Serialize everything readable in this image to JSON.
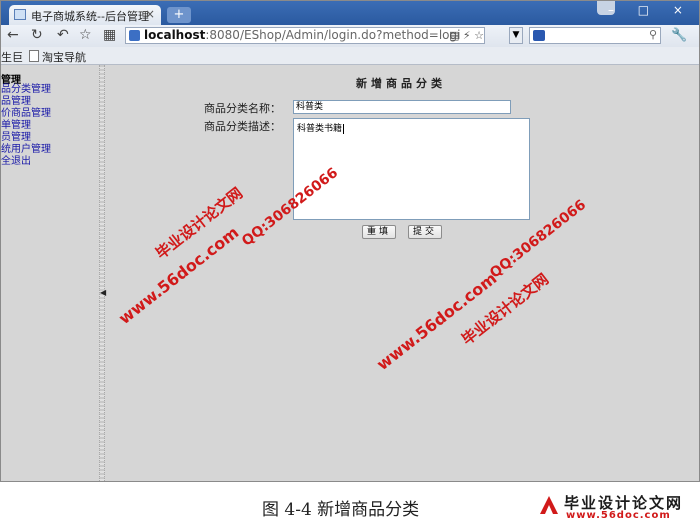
{
  "browser": {
    "tab_title": "电子商城系统--后台管理",
    "tab_close": "×",
    "new_tab": "+",
    "window_buttons": "– □ ×",
    "address_host": "localhost",
    "address_rest": ":8080/EShop/Admin/login.do?method=logi",
    "bookmarks": {
      "left_partial": "生巨",
      "taobao": "淘宝导航"
    }
  },
  "sidebar": {
    "title": "管理",
    "items": [
      {
        "label": "品分类管理"
      },
      {
        "label": "品管理"
      },
      {
        "label": "价商品管理"
      },
      {
        "label": "单管理"
      },
      {
        "label": "员管理"
      },
      {
        "label": "统用户管理"
      },
      {
        "label": "全退出"
      }
    ]
  },
  "form": {
    "title": "新增商品分类",
    "name_label": "商品分类名称：",
    "name_value": "科普类",
    "desc_label": "商品分类描述：",
    "desc_value": "科普类书籍",
    "reset_button": "重填",
    "submit_button": "提交"
  },
  "watermarks": {
    "site_cn": "毕业设计论文网",
    "site_url": "www.56doc.com",
    "qq": "QQ:306826066"
  },
  "caption": {
    "figure_label": "图 4-4 新增商品分类",
    "logo_text": "毕业设计论文网",
    "logo_url": "www.56doc.com"
  }
}
